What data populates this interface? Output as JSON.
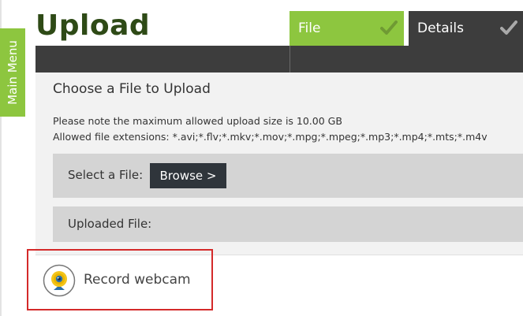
{
  "sidebar": {
    "main_menu_label": "Main Menu"
  },
  "page": {
    "title": "Upload"
  },
  "steps": [
    {
      "label": "File",
      "state": "active",
      "icon": "checkmark-icon"
    },
    {
      "label": "Details",
      "state": "inactive",
      "icon": "checkmark-icon"
    }
  ],
  "upload": {
    "heading": "Choose a File to Upload",
    "size_note": "Please note the maximum allowed upload size is 10.00 GB",
    "extensions_note": "Allowed file extensions: *.avi;*.flv;*.mkv;*.mov;*.mpg;*.mpeg;*.mp3;*.mp4;*.mts;*.m4v",
    "select_label": "Select a File:",
    "browse_label": "Browse >",
    "uploaded_label": "Uploaded File:"
  },
  "webcam": {
    "label": "Record webcam",
    "icon": "webcam-icon"
  },
  "colors": {
    "accent_green": "#8dc63f",
    "title_green": "#2e4a16",
    "dark_bar": "#3d3d3d",
    "button_dark": "#2f353b",
    "highlight_red": "#d42a2a"
  }
}
